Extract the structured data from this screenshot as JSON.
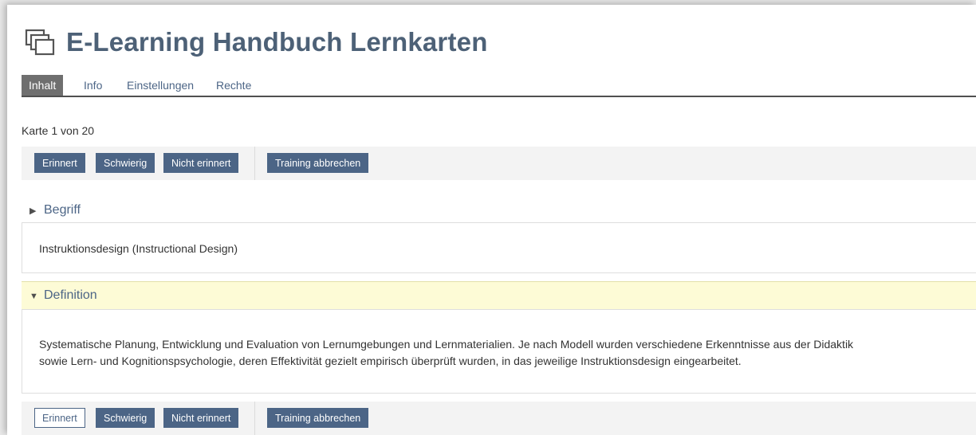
{
  "header": {
    "title": "E-Learning Handbuch Lernkarten",
    "icon": "flashcards-icon"
  },
  "tabs": [
    {
      "label": "Inhalt",
      "active": true
    },
    {
      "label": "Info",
      "active": false
    },
    {
      "label": "Einstellungen",
      "active": false
    },
    {
      "label": "Rechte",
      "active": false
    }
  ],
  "counter": "Karte 1 von 20",
  "toolbar_top": {
    "remembered": "Erinnert",
    "difficult": "Schwierig",
    "not_remembered": "Nicht erinnert",
    "cancel": "Training abbrechen"
  },
  "term": {
    "heading": "Begriff",
    "text": "Instruktionsdesign (Instructional Design)"
  },
  "definition": {
    "heading": "Definition",
    "line1": "Systematische Planung, Entwicklung und Evaluation von Lernumgebungen und Lernmaterialien. Je nach Modell wurden verschiedene Erkenntnisse aus der Didaktik",
    "line2": "sowie Lern- und Kognitionspsychologie, deren Effektivität gezielt empirisch überprüft wurden, in das jeweilige Instruktionsdesign eingearbeitet."
  },
  "toolbar_bottom": {
    "remembered": "Erinnert",
    "difficult": "Schwierig",
    "not_remembered": "Nicht erinnert",
    "cancel": "Training abbrechen"
  },
  "colors": {
    "accent": "#4c6586",
    "title": "#4d6177",
    "definition_bg": "#fdfbd6",
    "active_tab": "#6f6f6f"
  }
}
